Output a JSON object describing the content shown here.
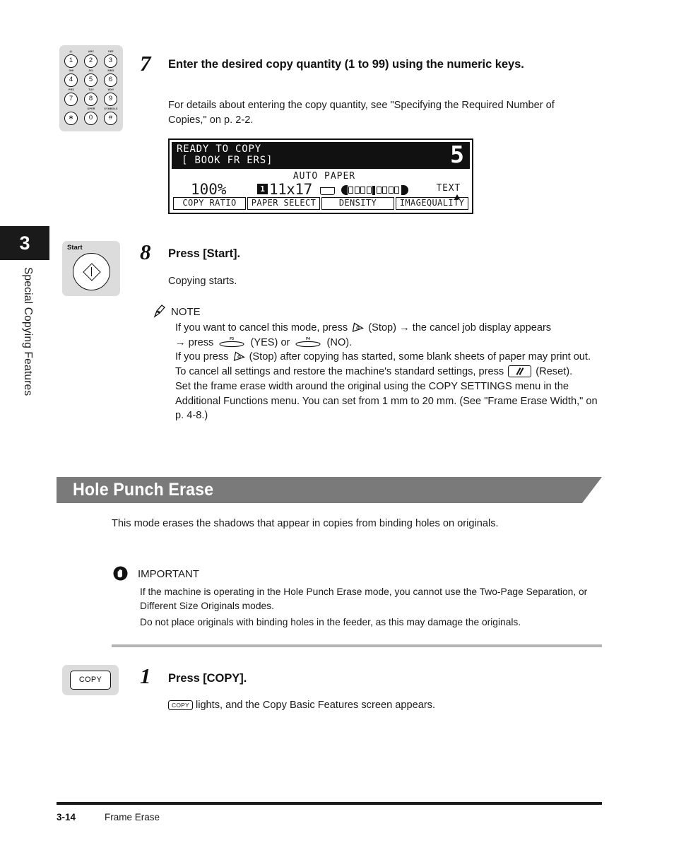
{
  "page": {
    "chapter_number": "3",
    "chapter_title": "Special Copying Features",
    "footer_page": "3-14",
    "footer_title": "Frame Erase"
  },
  "keypad": {
    "name": "numeric-keypad",
    "keys": [
      {
        "digit": "1",
        "sub": "@."
      },
      {
        "digit": "2",
        "sub": "ABC"
      },
      {
        "digit": "3",
        "sub": "DEF"
      },
      {
        "digit": "4",
        "sub": "GHI"
      },
      {
        "digit": "5",
        "sub": "JKL"
      },
      {
        "digit": "6",
        "sub": "MNO"
      },
      {
        "digit": "7",
        "sub": "PRS"
      },
      {
        "digit": "8",
        "sub": "TUV"
      },
      {
        "digit": "9",
        "sub": "WXY"
      },
      {
        "digit": "∗",
        "sub": ""
      },
      {
        "digit": "0",
        "sub": "OPER"
      },
      {
        "digit": "#",
        "sub": "SYMBOLS"
      }
    ]
  },
  "start_key": {
    "label": "Start"
  },
  "copy_key": {
    "label": "COPY",
    "inline_label": "COPY"
  },
  "step7": {
    "number": "7",
    "title": "Enter the desired copy quantity (1 to 99) using the numeric keys.",
    "body": "For details about entering the copy quantity, see \"Specifying the Required Number of Copies,\" on p. 2-2."
  },
  "lcd": {
    "line1": "READY TO COPY",
    "line2": "[ BOOK FR ERS]",
    "quantity": "5",
    "auto_paper": "AUTO PAPER",
    "ratio": "100%",
    "cassette": "1",
    "paper_size": "11x17",
    "image_type": "TEXT",
    "softkeys": [
      "COPY RATIO",
      "PAPER SELECT",
      "DENSITY",
      "IMAGEQUALITY"
    ]
  },
  "step8": {
    "number": "8",
    "title": "Press [Start].",
    "body": "Copying starts."
  },
  "note": {
    "heading": "NOTE",
    "line1_a": "If you want to cancel this mode, press",
    "line1_b": "(Stop)",
    "line1_c": "the cancel job display appears",
    "line2_a": "press",
    "line2_b": "(YES) or",
    "line2_c": "(NO).",
    "f3_label": "F3",
    "f4_label": "F4",
    "arrow": "→",
    "line3_a": "If you press",
    "line3_b": "(Stop) after copying has started, some blank sheets of paper may print out.",
    "line4_a": "To cancel all settings and restore the machine's standard settings, press",
    "line4_b": "(Reset).",
    "line5": "Set the frame erase width around the original using the COPY SETTINGS menu in the Additional Functions menu. You can set from 1 mm to 20 mm. (See \"Frame Erase Width,\" on p. 4-8.)"
  },
  "section": {
    "banner_title": "Hole Punch Erase",
    "intro": "This mode erases the shadows that appear in copies from binding holes on originals.",
    "important_heading": "IMPORTANT",
    "important_line1": "If the machine is operating in the Hole Punch Erase mode, you cannot use the Two-Page Separation, or Different Size Originals modes.",
    "important_line2": "Do not place originals with binding holes in the feeder, as this may damage the originals."
  },
  "step1": {
    "number": "1",
    "title": "Press [COPY].",
    "body_after_chip": "lights, and the Copy Basic Features screen appears."
  },
  "colors": {
    "banner_gray": "#7a7a7a",
    "tab_black": "#1a1a1a",
    "key_panel_gray": "#dcdcdc",
    "divider_gray": "#b4b4b4"
  }
}
